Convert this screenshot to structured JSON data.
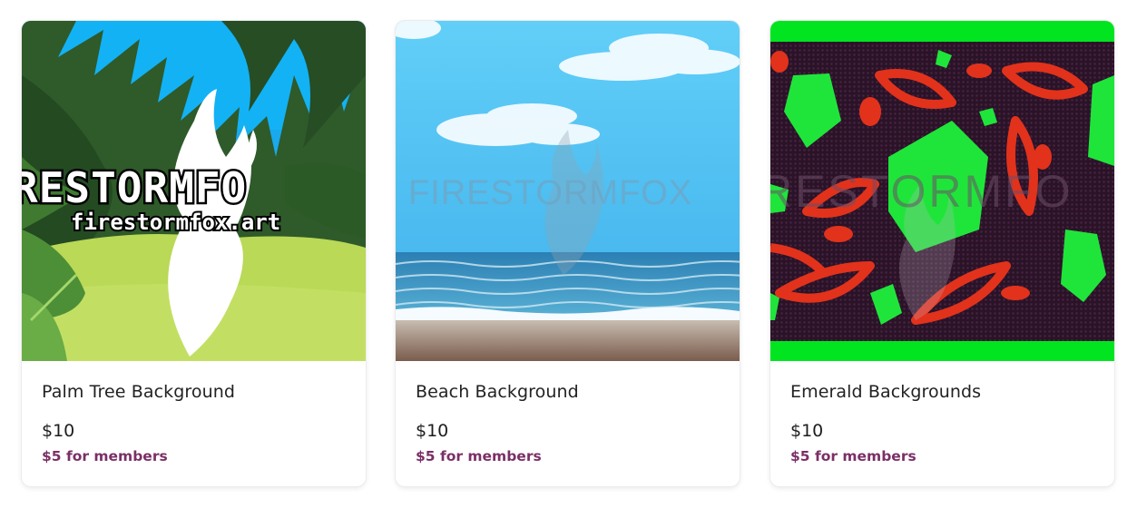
{
  "products": [
    {
      "title": "Palm Tree Background",
      "price": "$10",
      "member_price": "$5 for members",
      "watermark_text": "RESTORMFO",
      "watermark_url": "firestormfox.art"
    },
    {
      "title": "Beach Background",
      "price": "$10",
      "member_price": "$5 for members",
      "watermark_text": "FIRESTORMFOX"
    },
    {
      "title": "Emerald Backgrounds",
      "price": "$10",
      "member_price": "$5 for members",
      "watermark_text": "RESTORMFO"
    }
  ],
  "colors": {
    "member_price": "#7a2f66",
    "emerald_border": "#00e51f",
    "sky": "#49b9ef"
  }
}
